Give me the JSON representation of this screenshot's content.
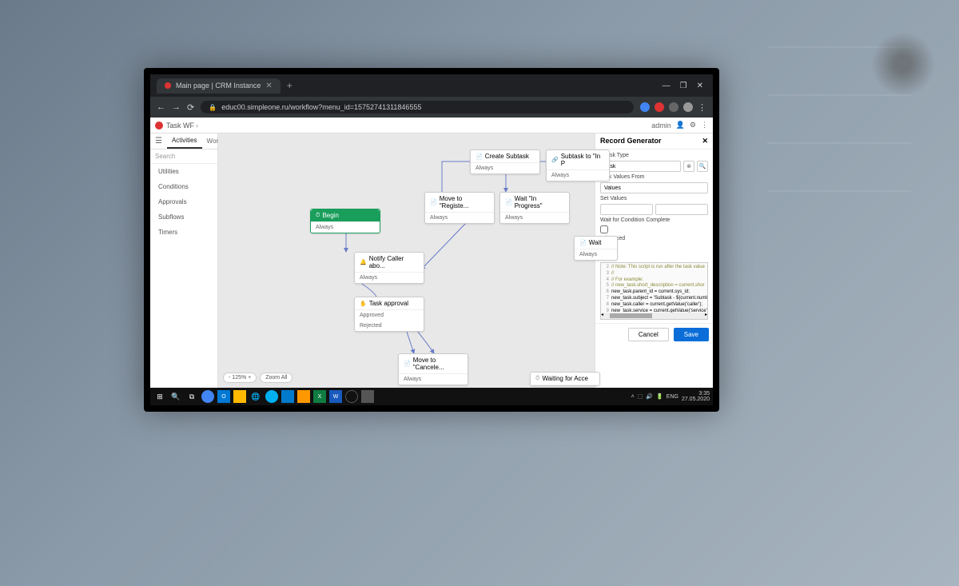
{
  "browser": {
    "tab_title": "Main page | CRM Instance",
    "url": "educ00.simpleone.ru/workflow?menu_id=15752741311846555"
  },
  "window": {
    "minimize": "—",
    "maximize": "❐",
    "close": "✕"
  },
  "app": {
    "breadcrumb": "Task WF",
    "user": "admin"
  },
  "sidebar": {
    "tab_activities": "Activities",
    "tab_workflows": "Workflows",
    "search_placeholder": "Search",
    "items": [
      "Utilities",
      "Conditions",
      "Approvals",
      "Subflows",
      "Timers"
    ]
  },
  "zoom": {
    "minus": "-",
    "level": "125%",
    "plus": "+",
    "zoom_all": "Zoom All"
  },
  "nodes": {
    "begin": {
      "title": "Begin",
      "out": "Always"
    },
    "notify": {
      "title": "Notify Caller abo...",
      "out": "Always"
    },
    "approval": {
      "title": "Task approval",
      "out1": "Approved",
      "out2": "Rejected"
    },
    "create_sub": {
      "title": "Create Subtask",
      "out": "Always"
    },
    "move_reg": {
      "title": "Move to \"Registe...",
      "out": "Always"
    },
    "wait_prog": {
      "title": "Wait \"In Progress\"",
      "out": "Always"
    },
    "subtask_inp": {
      "title": "Subtask to \"In P",
      "out": "Always"
    },
    "wait": {
      "title": "Wait",
      "out": "Always"
    },
    "move_cancel": {
      "title": "Move to \"Cancele...",
      "out": "Always"
    },
    "wait_acc": {
      "title": "Waiting for Acce"
    }
  },
  "panel": {
    "title": "Record Generator",
    "task_type_label": "Task Type",
    "task_type_value": "Task",
    "values_from_label": "Task Values From",
    "values_from_value": "Values",
    "set_values_label": "Set Values",
    "wait_cond_label": "Wait for Condition Complete",
    "advanced_label": "Advanced",
    "script_label": "Script",
    "script_lines": [
      "// Note: This script is run after the task value",
      "//",
      "// For example:",
      "//   new_task.short_description = current.shor",
      "new_task.parent_id = current.sys_id;",
      "new_task.subject = 'Subtask - ${current.number}'",
      "new_task.caller = current.getValue('caller');",
      "new_task.service = current.getValue('service');"
    ],
    "cancel": "Cancel",
    "save": "Save"
  },
  "taskbar": {
    "lang": "ENG",
    "time": "3:35",
    "date": "27.05.2020"
  }
}
